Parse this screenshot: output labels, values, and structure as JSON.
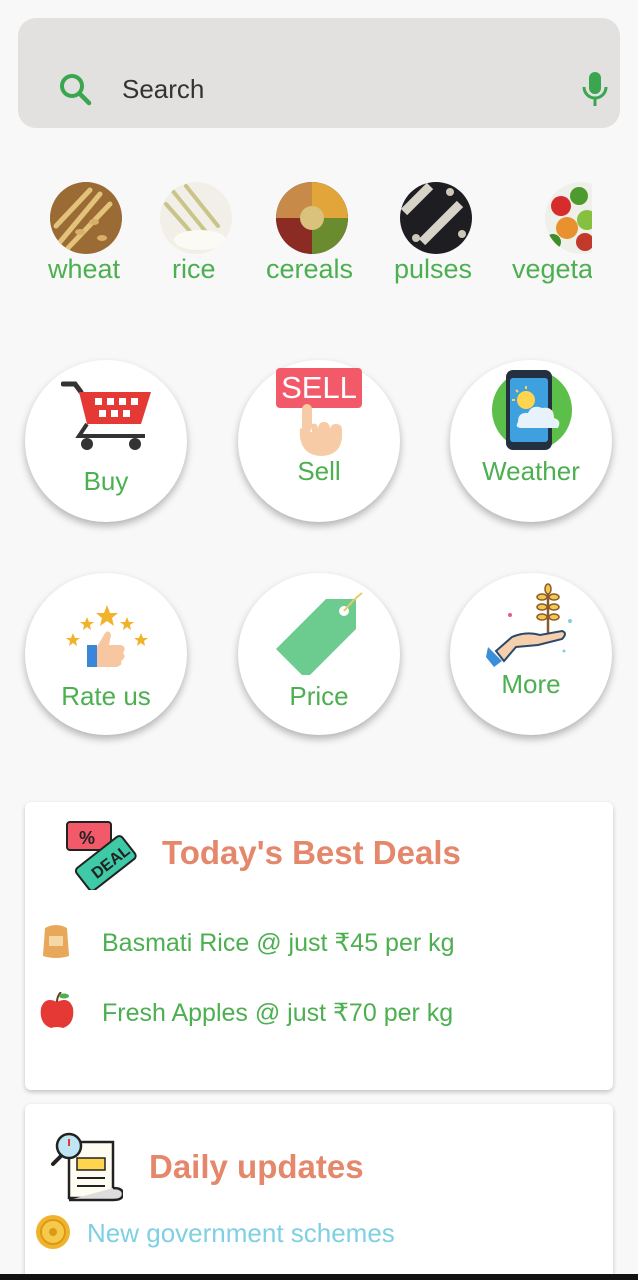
{
  "search": {
    "placeholder": "Search",
    "icon": "search-icon",
    "mic_icon": "microphone-icon"
  },
  "categories": [
    {
      "label": "wheat"
    },
    {
      "label": "rice"
    },
    {
      "label": "cereals"
    },
    {
      "label": "pulses"
    },
    {
      "label": "vegeta"
    }
  ],
  "tiles": {
    "buy": "Buy",
    "sell": "Sell",
    "sell_sign": "SELL",
    "weather": "Weather",
    "rate": "Rate us",
    "price": "Price",
    "more": "More"
  },
  "deals": {
    "title": "Today's Best Deals",
    "badge_pct": "%",
    "badge_text": "DEAL",
    "items": [
      {
        "text": "Basmati Rice @ just ₹45 per kg"
      },
      {
        "text": "Fresh Apples @ just ₹70 per kg"
      }
    ]
  },
  "updates": {
    "title": "Daily updates",
    "items": [
      {
        "text": "New government schemes"
      }
    ]
  },
  "colors": {
    "accent_green": "#4caf50",
    "title_orange": "#e4876b",
    "update_blue": "#7ed0e2"
  }
}
